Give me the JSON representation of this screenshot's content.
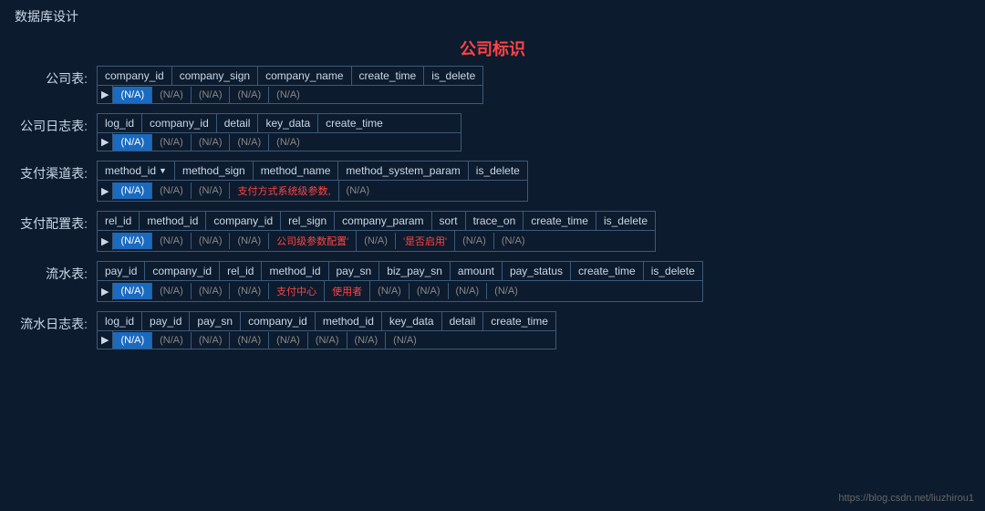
{
  "page": {
    "title": "数据库设计",
    "center_label": "公司标识",
    "watermark": "https://blog.csdn.net/liuzhirou1"
  },
  "tables": [
    {
      "label": "公司表:",
      "columns": [
        "company_id",
        "company_sign",
        "company_name",
        "create_time",
        "is_delete"
      ],
      "body_cells": [
        "(N/A)",
        "(N/A)",
        "(N/A)",
        "(N/A)",
        "(N/A)"
      ],
      "highlight_col": 0
    },
    {
      "label": "公司日志表:",
      "columns": [
        "log_id",
        "company_id",
        "detail",
        "key_data",
        "create_time"
      ],
      "body_cells": [
        "(N/A)",
        "(N/A)",
        "(N/A)",
        "(N/A)",
        "(N/A)"
      ],
      "highlight_col": 0
    },
    {
      "label": "支付渠道表:",
      "columns": [
        "method_id",
        "method_sign",
        "method_name",
        "method_system_param",
        "is_delete"
      ],
      "body_cells": [
        "(N/A)",
        "(N/A)",
        "(N/A)",
        "支付方式系统级参数,",
        "(N/A)"
      ],
      "highlight_col": 0,
      "dropdown_col": 0,
      "special_col": 3
    },
    {
      "label": "支付配置表:",
      "columns": [
        "rel_id",
        "method_id",
        "company_id",
        "rel_sign",
        "company_param",
        "sort",
        "trace_on",
        "create_time",
        "is_delete"
      ],
      "body_cells": [
        "(N/A)",
        "(N/A)",
        "(N/A)",
        "(N/A)",
        "公司级参数配置'",
        "(N/A)",
        "'是否启用'",
        "(N/A)",
        "(N/A)"
      ],
      "highlight_col": 0,
      "special_col": 4,
      "special_col2": 6
    },
    {
      "label": "流水表:",
      "columns": [
        "pay_id",
        "company_id",
        "rel_id",
        "method_id",
        "pay_sn",
        "biz_pay_sn",
        "amount",
        "pay_status",
        "create_time",
        "is_delete"
      ],
      "body_cells": [
        "(N/A)",
        "(N/A)",
        "(N/A)",
        "(N/A)",
        "支付中心",
        "使用者",
        "(N/A)",
        "(N/A)",
        "(N/A)",
        "(N/A)"
      ],
      "highlight_col": 0,
      "special_col": 4,
      "special_col2": 5
    },
    {
      "label": "流水日志表:",
      "columns": [
        "log_id",
        "pay_id",
        "pay_sn",
        "company_id",
        "method_id",
        "key_data",
        "detail",
        "create_time"
      ],
      "body_cells": [
        "(N/A)",
        "(N/A)",
        "(N/A)",
        "(N/A)",
        "(N/A)",
        "(N/A)",
        "(N/A)",
        "(N/A)"
      ],
      "highlight_col": 0
    }
  ]
}
